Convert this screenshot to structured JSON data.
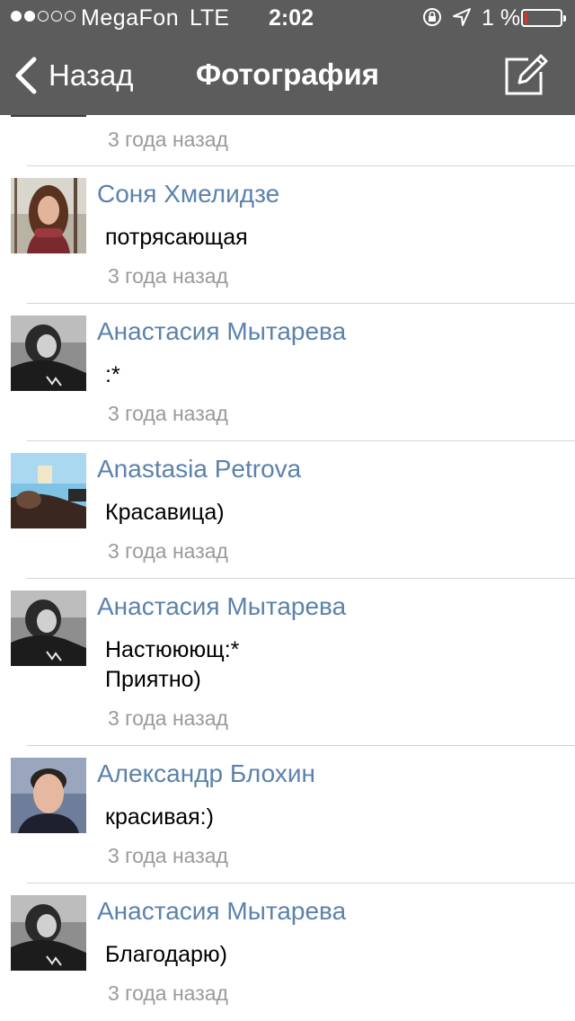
{
  "status_bar": {
    "carrier": "MegaFon",
    "network": "LTE",
    "time": "2:02",
    "battery_percent": "1 %",
    "battery_level": 0.01,
    "signal_strength": 2,
    "signal_max": 5
  },
  "nav": {
    "back_label": "Назад",
    "title": "Фотография",
    "compose_icon": "compose-icon",
    "back_icon": "chevron-left-icon"
  },
  "colors": {
    "header_bg": "#5c5c5c",
    "author_link": "#5b82ad",
    "timestamp": "#9a9a9a",
    "battery_low": "#e0312b"
  },
  "first_timestamp": "3 года назад",
  "comments": [
    {
      "author": "Соня Хмелидзе",
      "text": "потрясающая",
      "time": "3 года назад"
    },
    {
      "author": "Анастасия Мытарева",
      "text": ":*",
      "time": "3 года назад"
    },
    {
      "author": "Anastasia Petrova",
      "text": "Красавица)",
      "time": "3 года назад"
    },
    {
      "author": "Анастасия Мытарева",
      "text": "Настююющ:*\nПриятно)",
      "time": "3 года назад"
    },
    {
      "author": "Александр Блохин",
      "text": "красивая:)",
      "time": "3 года назад"
    },
    {
      "author": "Анастасия Мытарева",
      "text": "Благодарю)",
      "time": "3 года назад"
    }
  ]
}
